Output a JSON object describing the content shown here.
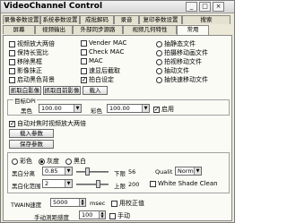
{
  "window": {
    "title": "VideoChannel Control",
    "min": "_",
    "max": "□",
    "close": "×"
  },
  "tabs_row1": [
    "录像参数设置",
    "系统参数设置",
    "成批解码",
    "录音",
    "复印参数设置",
    "搜索"
  ],
  "tabs_row2": [
    "屏幕",
    "视频输出",
    "外部同步源路",
    "视频几何特性",
    "常用"
  ],
  "checks_left": [
    {
      "label": "视频放大两倍",
      "checked": false
    },
    {
      "label": "保持长宽比",
      "checked": false
    },
    {
      "label": "移除黑框",
      "checked": false
    },
    {
      "label": "影像抹正",
      "checked": false
    },
    {
      "label": "启动黑色背景",
      "checked": false
    }
  ],
  "checks_mid": [
    {
      "label": "Vender MAC",
      "checked": false
    },
    {
      "label": "Check MAC",
      "checked": false
    },
    {
      "label": "MAC",
      "checked": false
    },
    {
      "label": "速显后截取",
      "checked": false
    },
    {
      "label": "拍白设定",
      "checked": true
    }
  ],
  "radios_right": [
    {
      "label": "抽静态文件",
      "checked": false
    },
    {
      "label": "拍摄移动画文件",
      "checked": false
    },
    {
      "label": "拍视移动文件",
      "checked": false
    },
    {
      "label": "抽动文件",
      "checked": false
    },
    {
      "label": "抽快速移动文件",
      "checked": false
    }
  ],
  "buttons_top": {
    "read_default": "抓取白影像",
    "read_current": "抓取目前影像",
    "load": "载入"
  },
  "target_group": {
    "title": "目标DPI",
    "black_label": "黑色",
    "black_value": "100.00",
    "color_label": "彩色",
    "color_value": "100.00",
    "enable_label": "启用",
    "enable_checked": true
  },
  "auto_label": "自动对焦时视频放大两倍",
  "load_params": "载入参数",
  "save_params": "保存参数",
  "image_group": {
    "radio_color": "彩色",
    "radio_gray": "灰度",
    "radio_bw": "黑白",
    "black_point_label": "黑白分离",
    "black_point_value": "0.85",
    "lower_label": "下限",
    "lower_value": "56",
    "quality_label": "Qualit",
    "quality_value": "Norm",
    "auto_range_label": "黑白化范围",
    "auto_range_value": "2",
    "upper_label": "上限",
    "upper_value": "200",
    "white_shade_label": "White Shade Clean"
  },
  "twain": {
    "label": "TWAIN速度",
    "value": "5000",
    "unit": "msec",
    "apply_label": "用校正值"
  },
  "footer": {
    "timeout_label": "手动测距感度",
    "timeout_value": "100",
    "unit_label": "手动"
  }
}
